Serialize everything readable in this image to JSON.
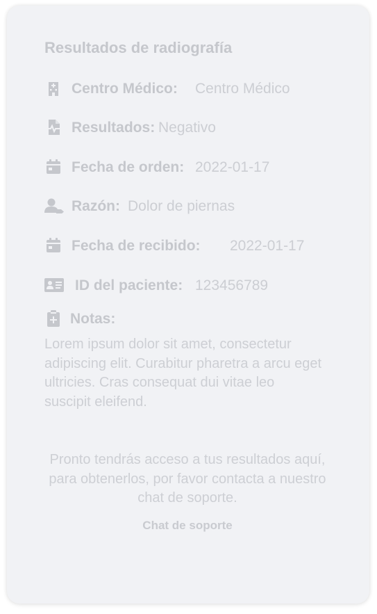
{
  "title": "Resultados de radiografía",
  "fields": {
    "centro": {
      "label": "Centro Médico:",
      "value": "Centro Médico",
      "icon": "hospital-icon"
    },
    "resultados": {
      "label": "Resultados:",
      "value": "Negativo",
      "icon": "medical-file-icon"
    },
    "fecha_orden": {
      "label": "Fecha de orden:",
      "value": "2022-01-17",
      "icon": "calendar-icon"
    },
    "razon": {
      "label": "Razón:",
      "value": "Dolor de piernas",
      "icon": "user-reason-icon"
    },
    "fecha_recibido": {
      "label": "Fecha de recibido:",
      "value": "2022-01-17",
      "icon": "calendar-icon"
    },
    "id_paciente": {
      "label": "ID del paciente:",
      "value": "123456789",
      "icon": "id-card-icon"
    },
    "notas": {
      "label": "Notas:",
      "icon": "clipboard-plus-icon"
    }
  },
  "notes_text": "Lorem ipsum dolor sit amet, consectetur adipiscing elit. Curabitur pharetra a arcu eget ultricies. Cras consequat dui vitae leo suscipit eleifend.",
  "info_text": "Pronto tendrás acceso a tus resultados aquí, para obtenerlos, por favor contacta a nuestro chat de soporte.",
  "chat_link": "Chat de soporte",
  "colors": {
    "card_background": "#f1f2f5",
    "text_muted": "#c5c7cc"
  }
}
